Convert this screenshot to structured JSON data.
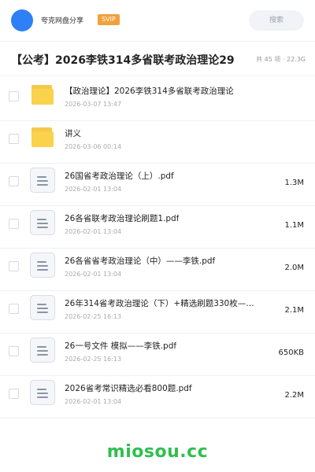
{
  "header": {
    "user_name": "夸克网盘分享",
    "badge": "SVIP",
    "search_placeholder": "搜索",
    "avatar_color": "#2f7ff7",
    "badge_color": "#f2a13b"
  },
  "share": {
    "title": "【公考】2026李铁314多省联考政治理论29",
    "meta": "共 45 项 · 22.3G"
  },
  "files": [
    {
      "type": "folder",
      "icon": "folder-icon",
      "name": "【政治理论】2026李铁314多省联考政治理论",
      "date": "2026-03-07 13:47",
      "size": ""
    },
    {
      "type": "folder",
      "icon": "folder-icon",
      "name": "讲义",
      "date": "2026-03-06 00:14",
      "size": ""
    },
    {
      "type": "file",
      "icon": "document-icon",
      "name": "26国省考政治理论（上）.pdf",
      "date": "2026-02-01 13:04",
      "size": "1.3M"
    },
    {
      "type": "file",
      "icon": "document-icon",
      "name": "26各省联考政治理论刷题1.pdf",
      "date": "2026-02-01 13:04",
      "size": "1.1M"
    },
    {
      "type": "file",
      "icon": "document-icon",
      "name": "26各省省考政治理论（中）——李铁.pdf",
      "date": "2026-02-01 13:04",
      "size": "2.0M"
    },
    {
      "type": "file",
      "icon": "document-icon",
      "name": "26年314省考政治理论（下）+精选刷题330枚—…",
      "date": "2026-02-25 16:13",
      "size": "2.1M"
    },
    {
      "type": "file",
      "icon": "document-icon",
      "name": "26一号文件 模拟——李铁.pdf",
      "date": "2026-02-25 16:13",
      "size": "650KB"
    },
    {
      "type": "file",
      "icon": "document-icon",
      "name": "2026省考常识精选必看800题.pdf",
      "date": "2026-02-01 13:04",
      "size": "2.2M"
    }
  ],
  "watermark": {
    "text": "miosou.cc",
    "color": "#2fbf4f"
  }
}
